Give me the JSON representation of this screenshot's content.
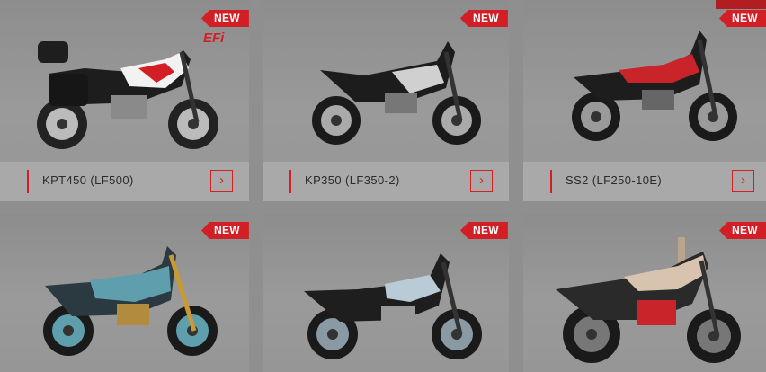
{
  "badge_label": "NEW",
  "efi_label": "EFi",
  "arrow_icon": "chevron-right-icon",
  "accent_color": "#d21f26",
  "products": [
    {
      "name": "KPT450 (LF500)",
      "badge": "NEW",
      "color": "#ffffff"
    },
    {
      "name": "KP350 (LF350-2)",
      "badge": "NEW",
      "color": "#d9d9d9"
    },
    {
      "name": "SS2 (LF250-10E)",
      "badge": "NEW",
      "color": "#c8242a"
    },
    {
      "name": "",
      "badge": "NEW",
      "color": "#5f9fad"
    },
    {
      "name": "",
      "badge": "NEW",
      "color": "#b9cbd6"
    },
    {
      "name": "",
      "badge": "NEW",
      "color": "#d8c3ae"
    }
  ]
}
